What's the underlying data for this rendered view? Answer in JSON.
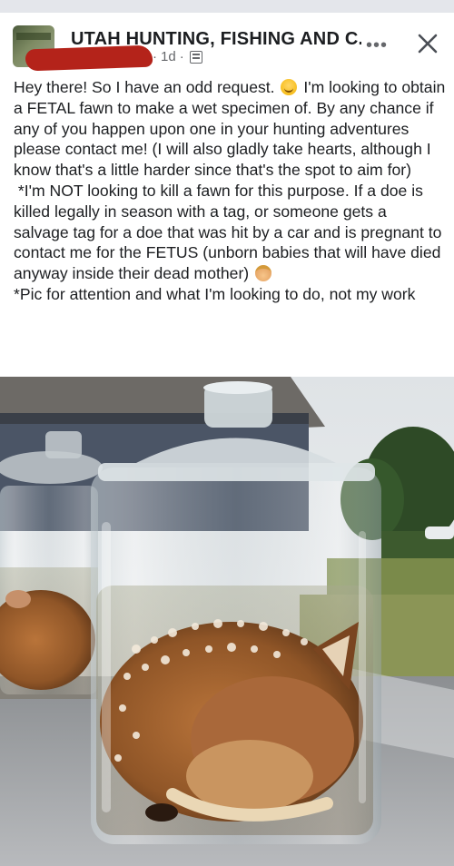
{
  "header": {
    "group_name": "UTAH HUNTING, FISHING AND C...",
    "time_ago": "1d",
    "separator": "·",
    "more_label": "•••"
  },
  "post": {
    "line1_a": "Hey there! So I have an odd request.",
    "line1_b": "I'm looking to obtain a FETAL fawn to make a wet specimen of. By any chance if any of you happen upon one in your hunting adventures please contact me! (I will also gladly take hearts, although I know that's a little harder since that's the spot to aim for)",
    "line2": "*I'm NOT looking to kill a fawn for this purpose. If a doe is killed legally in season with a tag, or someone gets a salvage tag for a doe that was hit by a car and is pregnant to contact me for the FETUS (unborn babies that will have died anyway inside their dead mother)",
    "line3": "*Pic for attention and what I'm looking to do, not my work"
  },
  "icons": {
    "avatar": "group-avatar",
    "privacy": "members-icon",
    "more": "more-icon",
    "close": "close-icon",
    "emoji1": "grinning-emoji",
    "emoji2": "facepalm-emoji"
  },
  "colors": {
    "text": "#1c1e21",
    "meta": "#65676b",
    "redaction": "#b4231a"
  }
}
